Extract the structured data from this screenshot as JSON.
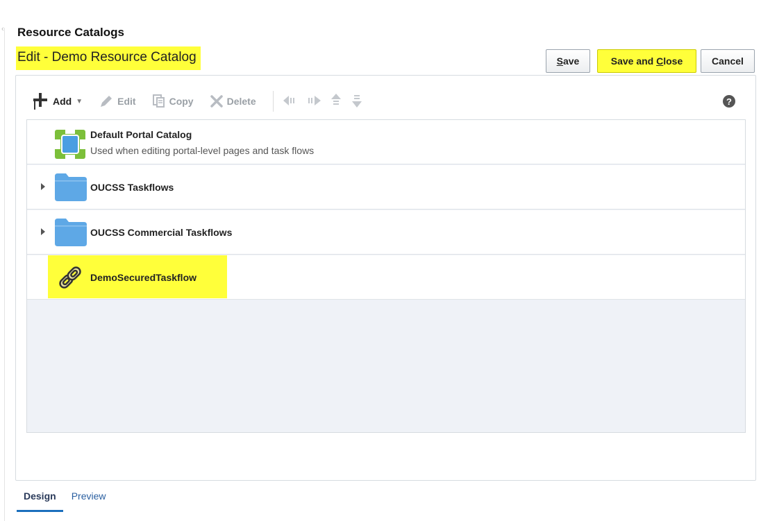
{
  "page": {
    "section_title": "Resource Catalogs",
    "edit_title": "Edit - Demo Resource Catalog"
  },
  "actions": {
    "save_prefix": "",
    "save_underline": "S",
    "save_rest": "ave",
    "save_close_prefix": "Save and ",
    "save_close_underline": "C",
    "save_close_rest": "lose",
    "cancel": "Cancel"
  },
  "toolbar": {
    "add": "Add",
    "edit": "Edit",
    "copy": "Copy",
    "delete": "Delete"
  },
  "catalog_items": [
    {
      "name": "Default Portal Catalog",
      "description": "Used when editing portal-level pages and task flows",
      "icon": "catalog-icon",
      "expandable": false
    },
    {
      "name": "OUCSS Taskflows",
      "description": "",
      "icon": "folder-icon",
      "expandable": true
    },
    {
      "name": "OUCSS Commercial Taskflows",
      "description": "",
      "icon": "folder-icon",
      "expandable": true
    },
    {
      "name": "DemoSecuredTaskflow",
      "description": "",
      "icon": "link-icon",
      "expandable": false,
      "highlighted": true
    }
  ],
  "tabs": [
    {
      "label": "Design",
      "active": true
    },
    {
      "label": "Preview",
      "active": false
    }
  ],
  "colors": {
    "highlight": "#ffff3a",
    "folder": "#5ea8e6",
    "catalog_green": "#7cbf3a",
    "tab_accent": "#1b6fbd"
  }
}
